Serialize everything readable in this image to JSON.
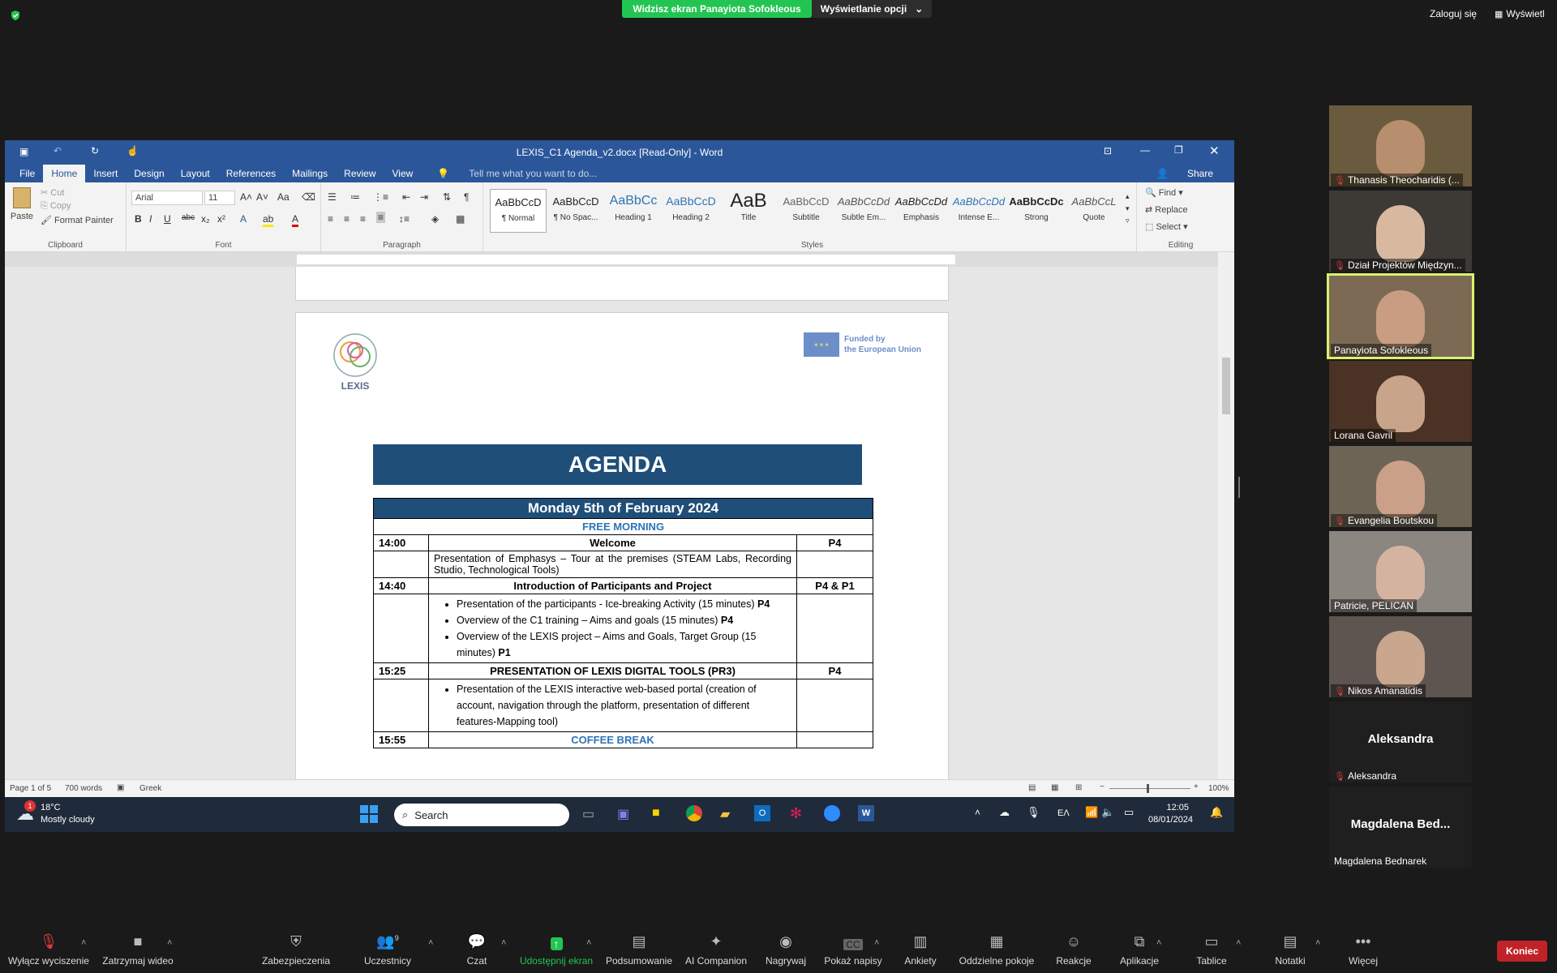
{
  "zoom": {
    "share_banner": "Widzisz ekran Panayiota Sofokleous",
    "view_options": "Wyświetlanie opcji",
    "login": "Zaloguj się",
    "view": "Wyświetl",
    "end": "Koniec"
  },
  "word": {
    "title": "LEXIS_C1 Agenda_v2.docx [Read-Only] - Word",
    "tabs": [
      "File",
      "Home",
      "Insert",
      "Design",
      "Layout",
      "References",
      "Mailings",
      "Review",
      "View"
    ],
    "tellme": "Tell me what you want to do...",
    "share": "Share",
    "clipboard": {
      "paste": "Paste",
      "cut": "Cut",
      "copy": "Copy",
      "format_painter": "Format Painter",
      "label": "Clipboard"
    },
    "font": {
      "name": "Arial",
      "size": "11",
      "label": "Font"
    },
    "paragraph_label": "Paragraph",
    "styles_label": "Styles",
    "styles": [
      {
        "preview": "AaBbCcD",
        "name": "¶ Normal"
      },
      {
        "preview": "AaBbCcD",
        "name": "¶ No Spac..."
      },
      {
        "preview": "AaBbCc",
        "name": "Heading 1"
      },
      {
        "preview": "AaBbCcD",
        "name": "Heading 2"
      },
      {
        "preview": "AaB",
        "name": "Title"
      },
      {
        "preview": "AaBbCcD",
        "name": "Subtitle"
      },
      {
        "preview": "AaBbCcDd",
        "name": "Subtle Em..."
      },
      {
        "preview": "AaBbCcDd",
        "name": "Emphasis"
      },
      {
        "preview": "AaBbCcDd",
        "name": "Intense E..."
      },
      {
        "preview": "AaBbCcDc",
        "name": "Strong"
      },
      {
        "preview": "AaBbCcL",
        "name": "Quote"
      }
    ],
    "editing": {
      "find": "Find",
      "replace": "Replace",
      "select": "Select",
      "label": "Editing"
    },
    "status": {
      "page": "Page 1 of 5",
      "words": "700 words",
      "lang": "Greek",
      "zoom": "100%"
    }
  },
  "doc": {
    "logo_text": "LEXIS",
    "eu_text_1": "Funded by",
    "eu_text_2": "the European Union",
    "agenda_title": "AGENDA",
    "day_header": "Monday 5th of February 2024",
    "free_morning": "FREE MORNING",
    "row1": {
      "time": "14:00",
      "title": "Welcome",
      "partner": "P4",
      "detail": "Presentation of Emphasys – Tour at the premises (STEAM Labs, Recording Studio, Technological Tools)"
    },
    "row2": {
      "time": "14:40",
      "title": "Introduction of Participants and Project",
      "partner": "P4 & P1",
      "bullets": [
        {
          "text": "Presentation of the participants - Ice-breaking Activity (15 minutes) ",
          "bold": "P4"
        },
        {
          "text": "Overview of the C1 training – Aims and goals (15 minutes) ",
          "bold": "P4"
        },
        {
          "text": "Overview of the LEXIS project – Aims and Goals, Target Group (15 minutes) ",
          "bold": "P1"
        }
      ]
    },
    "row3": {
      "time": "15:25",
      "title": "PRESENTATION OF LEXIS DIGITAL TOOLS (PR3)",
      "partner": "P4",
      "bullets": [
        {
          "text": "Presentation of the LEXIS interactive web-based portal (creation of account, navigation through the platform, presentation of different features-Mapping tool)",
          "bold": ""
        }
      ]
    },
    "row4": {
      "time": "15:55",
      "title": "COFFEE BREAK"
    }
  },
  "taskbar": {
    "weather_temp": "18°C",
    "weather_desc": "Mostly cloudy",
    "weather_badge": "1",
    "search": "Search",
    "time": "12:05",
    "date": "08/01/2024",
    "lang": "ΕΛ"
  },
  "participants": [
    {
      "name": "Thanasis Theocharidis (..."
    },
    {
      "name": "Dział Projektów Międzyn..."
    },
    {
      "name": "Panayiota Sofokleous"
    },
    {
      "name": "Lorana Gavril"
    },
    {
      "name": "Evangelia Boutskou"
    },
    {
      "name": "Patricie, PELICAN"
    },
    {
      "name": "Nikos Amanatidis"
    },
    {
      "name": "Aleksandra",
      "big": "Aleksandra"
    },
    {
      "name": "Magdalena Bednarek",
      "big": "Magdalena  Bed..."
    }
  ],
  "toolbar": {
    "mute": "Wyłącz wyciszenie",
    "video": "Zatrzymaj wideo",
    "security": "Zabezpieczenia",
    "participants": "Uczestnicy",
    "participants_count": "9",
    "chat": "Czat",
    "share": "Udostępnij ekran",
    "summary": "Podsumowanie",
    "ai": "AI Companion",
    "record": "Nagrywaj",
    "captions": "Pokaż napisy",
    "polls": "Ankiety",
    "breakout": "Oddzielne pokoje",
    "reactions": "Reakcje",
    "apps": "Aplikacje",
    "whiteboards": "Tablice",
    "notes": "Notatki",
    "more": "Więcej"
  },
  "colors": {
    "word_blue": "#2b579a",
    "agenda_blue": "#1f4e79",
    "zoom_green": "#23c552",
    "end_red": "#c0222a"
  }
}
